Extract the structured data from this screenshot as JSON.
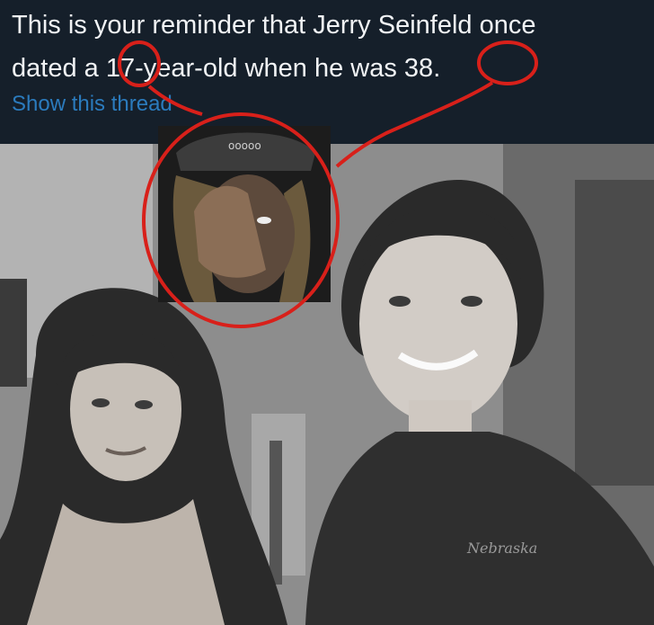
{
  "tweet": {
    "line1": "This is your reminder that Jerry Seinfeld once",
    "line2": {
      "pre": "dated a ",
      "age1": "17",
      "mid": "-year-old when he was ",
      "age2": "38",
      "post": "."
    },
    "show_thread": "Show this thread"
  },
  "photo": {
    "caption_on_shirt": "Nebraska"
  },
  "inset": {
    "cap_text": "ooooo"
  },
  "colors": {
    "header_bg": "#151f2a",
    "text": "#f1f3f5",
    "link": "#2b7bbd",
    "annotation_red": "#d8201a"
  }
}
